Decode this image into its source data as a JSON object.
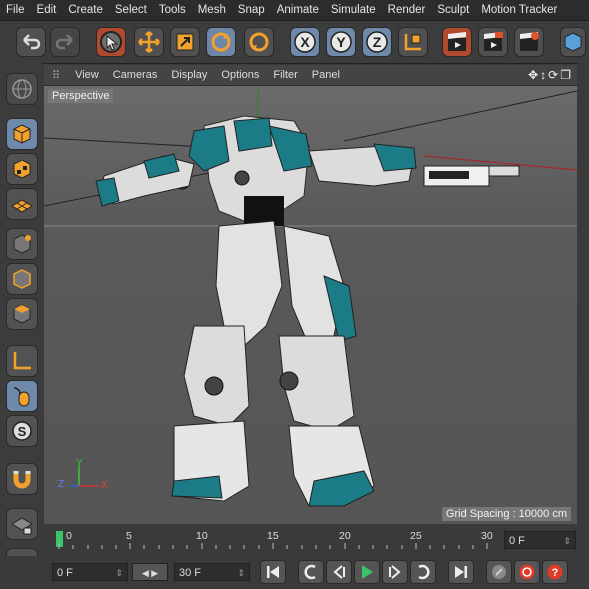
{
  "menu": [
    "File",
    "Edit",
    "Create",
    "Select",
    "Tools",
    "Mesh",
    "Snap",
    "Animate",
    "Simulate",
    "Render",
    "Sculpt",
    "Motion Tracker"
  ],
  "toolbar": {
    "icons": [
      "undo-icon",
      "redo-icon",
      "select-icon",
      "move-icon",
      "scale-icon",
      "rotate-icon",
      "recent-tool-icon",
      "x-axis-icon",
      "y-axis-icon",
      "z-axis-icon",
      "coordinate-system-icon",
      "render-view-icon",
      "render-picture-viewer-icon",
      "render-settings-icon",
      "cube-icon"
    ]
  },
  "viewport_menu": [
    "View",
    "Cameras",
    "Display",
    "Options",
    "Filter",
    "Panel"
  ],
  "viewport": {
    "camera_label": "Perspective",
    "grid_spacing": "Grid Spacing : 10000 cm",
    "axis_labels": {
      "y": "Y",
      "z": "Z",
      "x": "X"
    }
  },
  "timeline": {
    "ticks": [
      "0",
      "5",
      "10",
      "15",
      "20",
      "25",
      "30"
    ],
    "current_frame": "0 F"
  },
  "transport": {
    "start_field": "0 F",
    "end_field": "30 F"
  },
  "colors": {
    "accent": "#6f89ab",
    "teal": "#1b7b86",
    "active_green": "#3cc46a"
  }
}
